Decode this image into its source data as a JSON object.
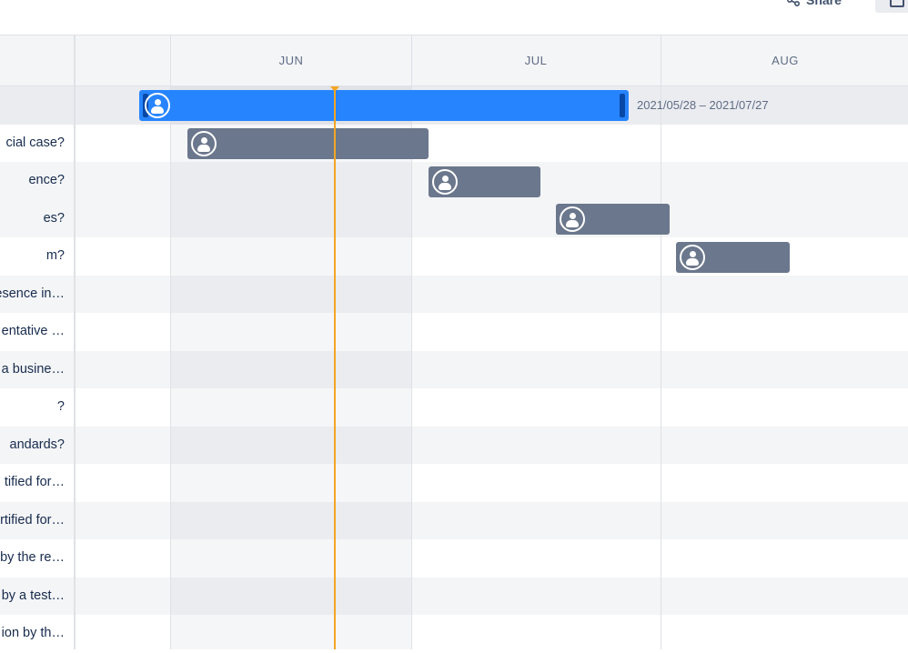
{
  "toolbar": {
    "share_label": "Share"
  },
  "timeline": {
    "months": [
      "JUN",
      "JUL",
      "AUG"
    ],
    "epic_date_range": "2021/05/28 – 2021/07/27"
  },
  "rows": [
    {
      "label": ""
    },
    {
      "label": "cial case?"
    },
    {
      "label": "ence?"
    },
    {
      "label": "es?"
    },
    {
      "label": "m?"
    },
    {
      "label": "esence in…"
    },
    {
      "label": "entative …"
    },
    {
      "label": "a busine…"
    },
    {
      "label": "?"
    },
    {
      "label": "andards?"
    },
    {
      "label": "tified for…"
    },
    {
      "label": "rtified for…"
    },
    {
      "label": "by the re…"
    },
    {
      "label": "by a test…"
    },
    {
      "label": "ion by th…"
    }
  ],
  "colors": {
    "epic_bar": "#2684ff",
    "issue_bar": "#6b778c",
    "today_line": "#f5a623"
  }
}
